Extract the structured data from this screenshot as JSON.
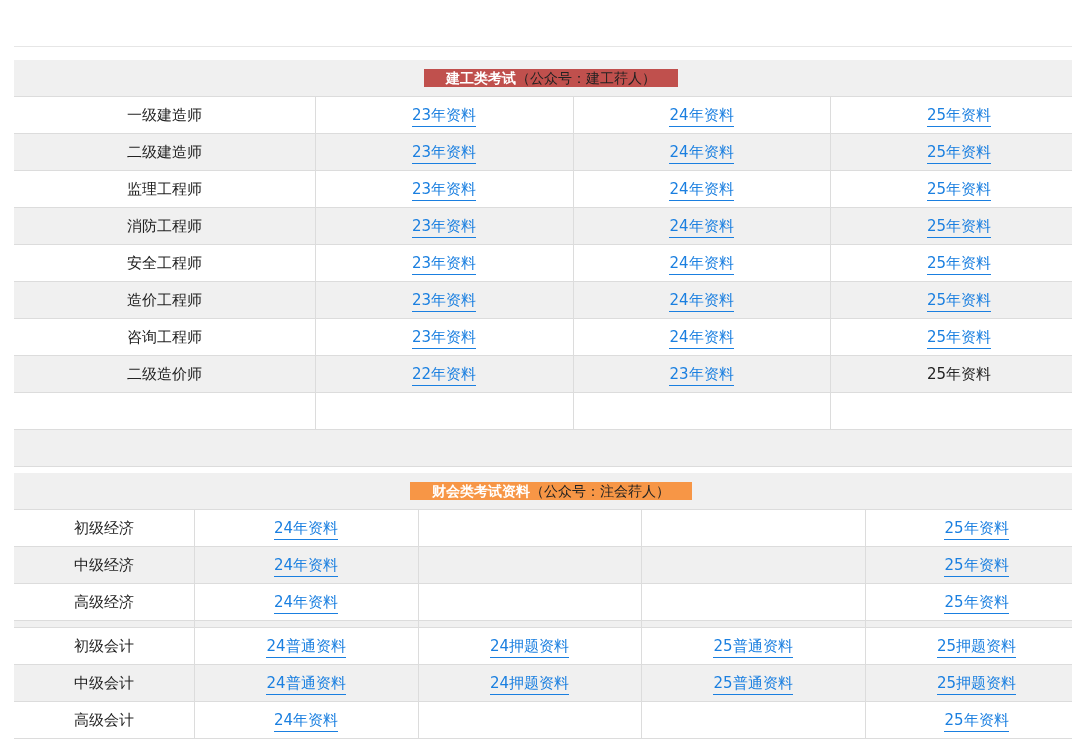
{
  "sections": [
    {
      "title": "建工类考试",
      "subtitle": "（公众号：建工荇人）",
      "color": "#c0504d",
      "rows": [
        {
          "kind": "data",
          "label": "一级建造师",
          "cells": [
            {
              "kind": "link",
              "text": "23年资料"
            },
            {
              "kind": "link",
              "text": "24年资料"
            },
            {
              "kind": "link",
              "text": "25年资料"
            }
          ]
        },
        {
          "kind": "data",
          "label": "二级建造师",
          "cells": [
            {
              "kind": "link",
              "text": "23年资料"
            },
            {
              "kind": "link",
              "text": "24年资料"
            },
            {
              "kind": "link",
              "text": "25年资料"
            }
          ]
        },
        {
          "kind": "data",
          "label": "监理工程师",
          "cells": [
            {
              "kind": "link",
              "text": "23年资料"
            },
            {
              "kind": "link",
              "text": "24年资料"
            },
            {
              "kind": "link",
              "text": "25年资料"
            }
          ]
        },
        {
          "kind": "data",
          "label": "消防工程师",
          "cells": [
            {
              "kind": "link",
              "text": "23年资料"
            },
            {
              "kind": "link",
              "text": "24年资料"
            },
            {
              "kind": "link",
              "text": "25年资料"
            }
          ]
        },
        {
          "kind": "data",
          "label": "安全工程师",
          "cells": [
            {
              "kind": "link",
              "text": "23年资料"
            },
            {
              "kind": "link",
              "text": "24年资料"
            },
            {
              "kind": "link",
              "text": "25年资料"
            }
          ]
        },
        {
          "kind": "data",
          "label": "造价工程师",
          "cells": [
            {
              "kind": "link",
              "text": "23年资料"
            },
            {
              "kind": "link",
              "text": "24年资料"
            },
            {
              "kind": "link",
              "text": "25年资料"
            }
          ]
        },
        {
          "kind": "data",
          "label": "咨询工程师",
          "cells": [
            {
              "kind": "link",
              "text": "23年资料"
            },
            {
              "kind": "link",
              "text": "24年资料"
            },
            {
              "kind": "link",
              "text": "25年资料"
            }
          ]
        },
        {
          "kind": "data",
          "label": "二级造价师",
          "cells": [
            {
              "kind": "link",
              "text": "22年资料"
            },
            {
              "kind": "link",
              "text": "23年资料"
            },
            {
              "kind": "plain",
              "text": "25年资料"
            }
          ]
        },
        {
          "kind": "blank"
        },
        {
          "kind": "spacer"
        }
      ]
    },
    {
      "title": "财会类考试资料",
      "subtitle": "（公众号：注会荇人）",
      "color": "#f79646",
      "rows": [
        {
          "kind": "data",
          "label": "初级经济",
          "cells": [
            {
              "kind": "link",
              "text": "24年资料"
            },
            {
              "kind": "empty"
            },
            {
              "kind": "empty"
            },
            {
              "kind": "link",
              "text": "25年资料"
            }
          ]
        },
        {
          "kind": "data",
          "label": "中级经济",
          "cells": [
            {
              "kind": "link",
              "text": "24年资料"
            },
            {
              "kind": "empty"
            },
            {
              "kind": "empty"
            },
            {
              "kind": "link",
              "text": "25年资料"
            }
          ]
        },
        {
          "kind": "data",
          "label": "高级经济",
          "cells": [
            {
              "kind": "link",
              "text": "24年资料"
            },
            {
              "kind": "empty"
            },
            {
              "kind": "empty"
            },
            {
              "kind": "link",
              "text": "25年资料"
            }
          ]
        },
        {
          "kind": "separator"
        },
        {
          "kind": "data",
          "label": "初级会计",
          "cells": [
            {
              "kind": "link",
              "text": "24普通资料"
            },
            {
              "kind": "link",
              "text": "24押题资料"
            },
            {
              "kind": "link",
              "text": "25普通资料"
            },
            {
              "kind": "link",
              "text": "25押题资料"
            }
          ]
        },
        {
          "kind": "data",
          "label": "中级会计",
          "cells": [
            {
              "kind": "link",
              "text": "24普通资料"
            },
            {
              "kind": "link",
              "text": "24押题资料"
            },
            {
              "kind": "link",
              "text": "25普通资料"
            },
            {
              "kind": "link",
              "text": "25押题资料"
            }
          ]
        },
        {
          "kind": "data",
          "label": "高级会计",
          "cells": [
            {
              "kind": "link",
              "text": "24年资料"
            },
            {
              "kind": "empty"
            },
            {
              "kind": "empty"
            },
            {
              "kind": "link",
              "text": "25年资料"
            }
          ]
        }
      ]
    }
  ]
}
